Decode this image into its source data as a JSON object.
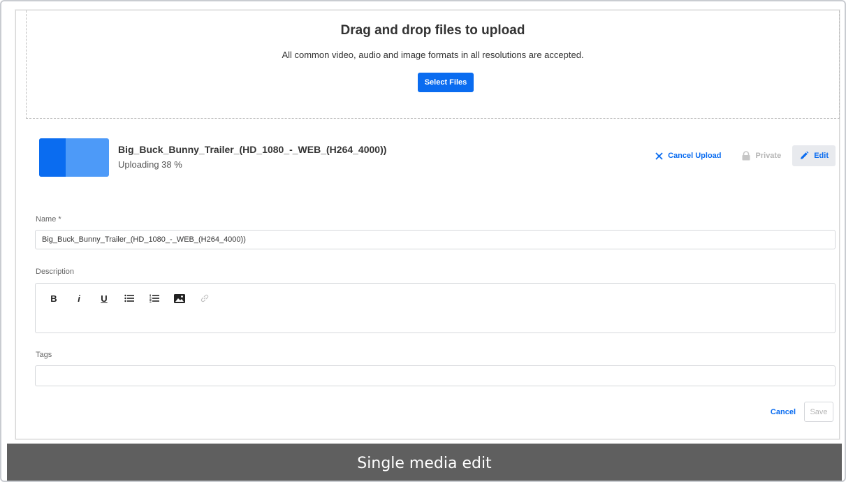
{
  "dropzone": {
    "title": "Drag and drop files to upload",
    "subtitle": "All common video, audio and image formats in all resolutions are accepted.",
    "select_label": "Select Files"
  },
  "upload": {
    "file_name": "Big_Buck_Bunny_Trailer_(HD_1080_-_WEB_(H264_4000))",
    "status": "Uploading 38 %",
    "progress_percent": 38,
    "actions": {
      "cancel_upload": "Cancel Upload",
      "private": "Private",
      "edit": "Edit"
    }
  },
  "form": {
    "name_label": "Name *",
    "name_value": "Big_Buck_Bunny_Trailer_(HD_1080_-_WEB_(H264_4000))",
    "description_label": "Description",
    "toolbar": {
      "bold": "B",
      "italic": "i",
      "underline": "U"
    },
    "toolbar_icons": [
      "bullet-list-icon",
      "numbered-list-icon",
      "image-icon",
      "link-icon"
    ],
    "tags_label": "Tags",
    "tags_value": "",
    "cancel_label": "Cancel",
    "save_label": "Save"
  },
  "caption": "Single media edit",
  "colors": {
    "accent": "#0a6cf0",
    "accent_light": "#4d9af8",
    "disabled": "#b5b5b5",
    "caption_bg": "#5f5f5f"
  }
}
